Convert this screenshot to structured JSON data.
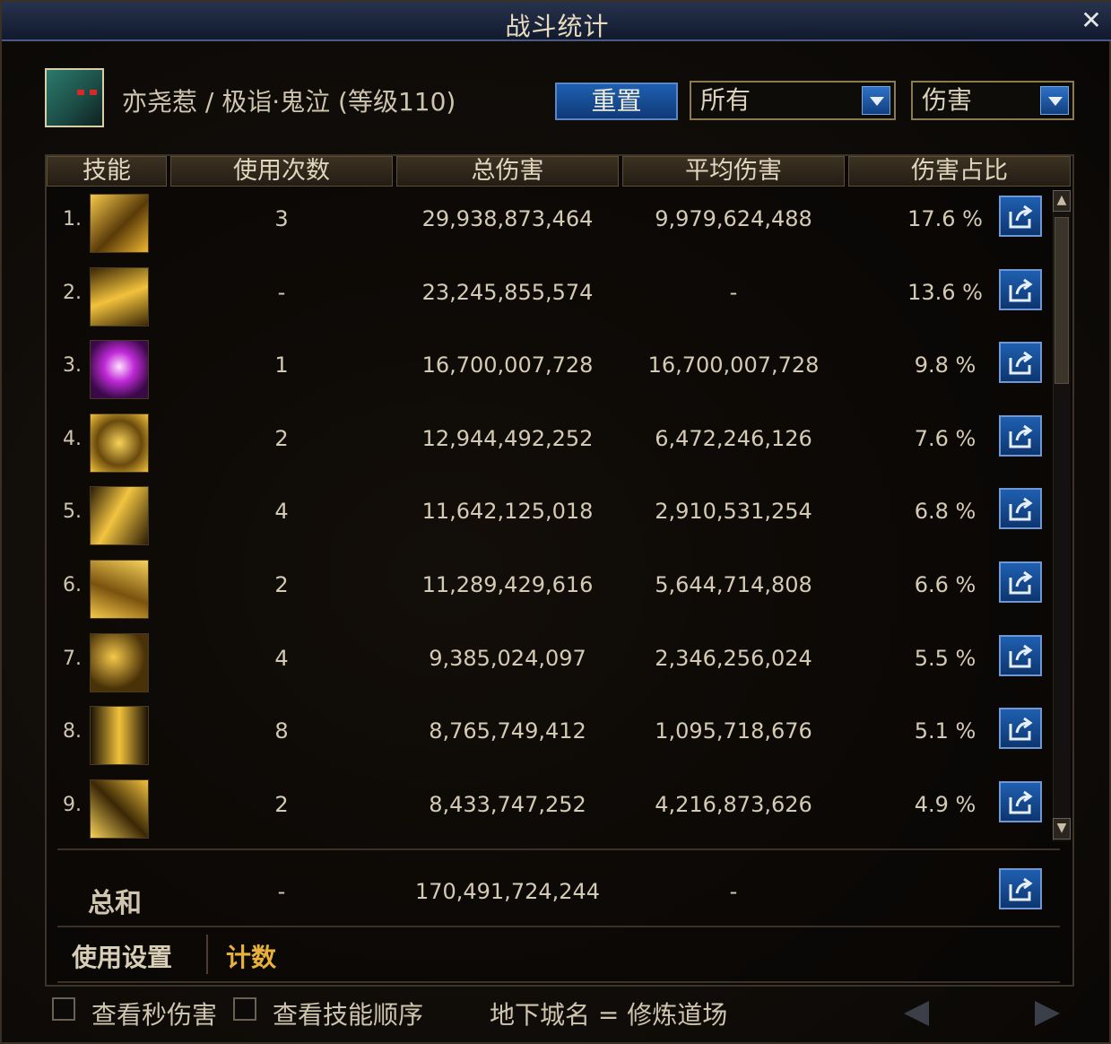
{
  "window": {
    "title": "战斗统计"
  },
  "character": {
    "name": "亦尧惹 / 极诣·鬼泣 (等级110)"
  },
  "controls": {
    "reset_label": "重置",
    "filter_value": "所有",
    "metric_value": "伤害"
  },
  "table": {
    "headers": [
      "技能",
      "使用次数",
      "总伤害",
      "平均伤害",
      "伤害占比"
    ],
    "rows": [
      {
        "rank": "1.",
        "uses": "3",
        "total": "29,938,873,464",
        "avg": "9,979,624,488",
        "pct": "17.6 %",
        "icon": "golden-claw-skill-icon"
      },
      {
        "rank": "2.",
        "uses": "-",
        "total": "23,245,855,574",
        "avg": "-",
        "pct": "13.6 %",
        "icon": "golden-flame-skill-icon"
      },
      {
        "rank": "3.",
        "uses": "1",
        "total": "16,700,007,728",
        "avg": "16,700,007,728",
        "pct": "9.8 %",
        "icon": "purple-burst-skill-icon"
      },
      {
        "rank": "4.",
        "uses": "2",
        "total": "12,944,492,252",
        "avg": "6,472,246,126",
        "pct": "7.6 %",
        "icon": "golden-star-skill-icon"
      },
      {
        "rank": "5.",
        "uses": "4",
        "total": "11,642,125,018",
        "avg": "2,910,531,254",
        "pct": "6.8 %",
        "icon": "golden-blossom-skill-icon"
      },
      {
        "rank": "6.",
        "uses": "2",
        "total": "11,289,429,616",
        "avg": "5,644,714,808",
        "pct": "6.6 %",
        "icon": "golden-crescent-skill-icon"
      },
      {
        "rank": "7.",
        "uses": "4",
        "total": "9,385,024,097",
        "avg": "2,346,256,024",
        "pct": "5.5 %",
        "icon": "golden-mask-skill-icon"
      },
      {
        "rank": "8.",
        "uses": "8",
        "total": "8,765,749,412",
        "avg": "1,095,718,676",
        "pct": "5.1 %",
        "icon": "golden-slash-skill-icon"
      },
      {
        "rank": "9.",
        "uses": "2",
        "total": "8,433,747,252",
        "avg": "4,216,873,626",
        "pct": "4.9 %",
        "icon": "golden-blade-skill-icon"
      }
    ],
    "sum": {
      "label": "总和",
      "uses": "-",
      "total": "170,491,724,244",
      "avg": "-"
    }
  },
  "tabs": {
    "settings": "使用设置",
    "count": "计数"
  },
  "footer": {
    "check_dps": "查看秒伤害",
    "check_order": "查看技能顺序",
    "dungeon": "地下城名 = 修炼道场"
  },
  "colors": {
    "accent_blue": "#1f5fb0",
    "gold_tab": "#e8b23a",
    "frame": "#3d3428"
  }
}
